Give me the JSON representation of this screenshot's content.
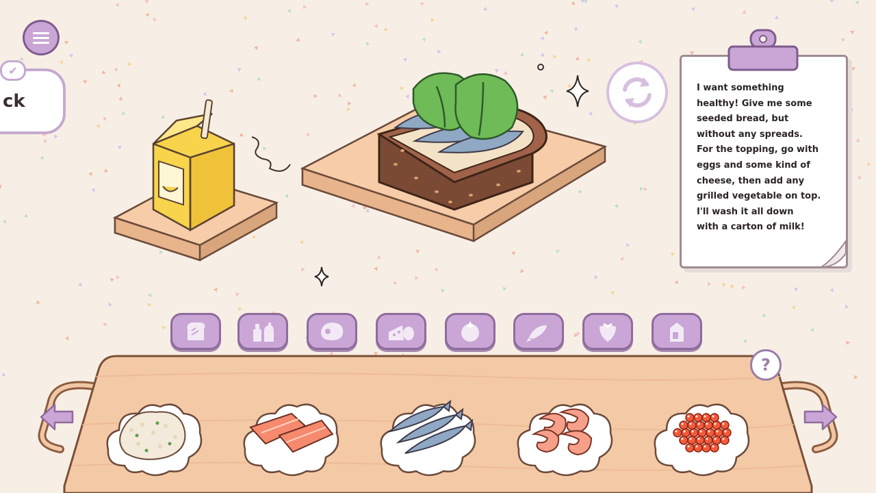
{
  "order": {
    "lines": [
      "I want something",
      "healthy! Give me some",
      "seeded bread, but",
      "without any spreads.",
      "For the topping, go with",
      "eggs and some kind of",
      "cheese, then add any",
      "grilled vegetable on top.",
      "I'll wash it all down",
      "with a carton of milk!"
    ]
  },
  "check_bubble": {
    "label": "ck"
  },
  "help": {
    "label": "?"
  },
  "categories": [
    {
      "icon": "bread-icon"
    },
    {
      "icon": "condiments-icon"
    },
    {
      "icon": "meat-icon"
    },
    {
      "icon": "cheese-egg-icon"
    },
    {
      "icon": "tomato-icon"
    },
    {
      "icon": "fish-icon"
    },
    {
      "icon": "strawberry-icon"
    },
    {
      "icon": "drink-carton-icon"
    }
  ],
  "ingredients": [
    {
      "name": "rice",
      "icon": "rice-icon"
    },
    {
      "name": "salmon",
      "icon": "salmon-icon"
    },
    {
      "name": "sardines",
      "icon": "sardines-icon"
    },
    {
      "name": "shrimp",
      "icon": "shrimp-icon"
    },
    {
      "name": "salmon roe",
      "icon": "roe-icon"
    }
  ],
  "colors": {
    "background": "#f7efe6",
    "accent_purple": "#c9a6d6",
    "wood": "#f4c9a6"
  }
}
